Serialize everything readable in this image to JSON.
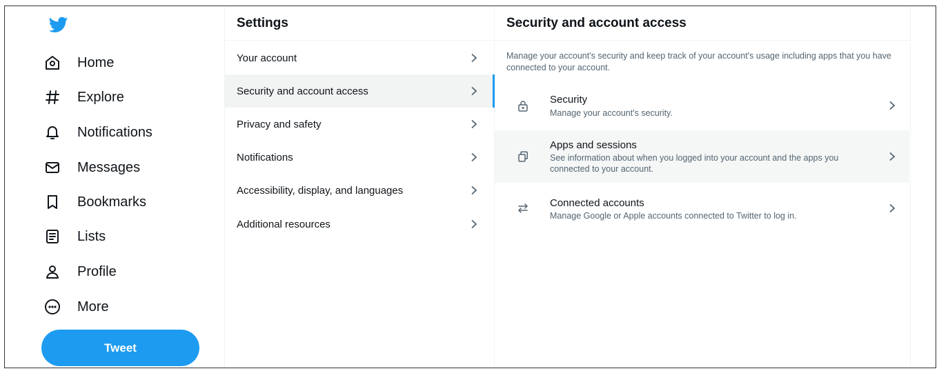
{
  "nav": {
    "items": [
      {
        "label": "Home",
        "icon": "home-icon"
      },
      {
        "label": "Explore",
        "icon": "hashtag-icon"
      },
      {
        "label": "Notifications",
        "icon": "bell-icon"
      },
      {
        "label": "Messages",
        "icon": "envelope-icon"
      },
      {
        "label": "Bookmarks",
        "icon": "bookmark-icon"
      },
      {
        "label": "Lists",
        "icon": "list-icon"
      },
      {
        "label": "Profile",
        "icon": "person-icon"
      },
      {
        "label": "More",
        "icon": "more-icon"
      }
    ],
    "tweet_label": "Tweet"
  },
  "settings": {
    "title": "Settings",
    "items": [
      {
        "label": "Your account"
      },
      {
        "label": "Security and account access",
        "active": true
      },
      {
        "label": "Privacy and safety"
      },
      {
        "label": "Notifications"
      },
      {
        "label": "Accessibility, display, and languages"
      },
      {
        "label": "Additional resources"
      }
    ]
  },
  "detail": {
    "title": "Security and account access",
    "description": "Manage your account's security and keep track of your account's usage including apps that you have connected to your account.",
    "items": [
      {
        "title": "Security",
        "subtitle": "Manage your account's security.",
        "icon": "lock-icon"
      },
      {
        "title": "Apps and sessions",
        "subtitle": "See information about when you logged into your account and the apps you connected to your account.",
        "icon": "copy-icon"
      },
      {
        "title": "Connected accounts",
        "subtitle": "Manage Google or Apple accounts connected to Twitter to log in.",
        "icon": "arrows-swap-icon"
      }
    ]
  },
  "colors": {
    "accent": "#1d9bf0",
    "text": "#0f1419",
    "muted": "#536471",
    "active_row": "#f2f3f3"
  }
}
